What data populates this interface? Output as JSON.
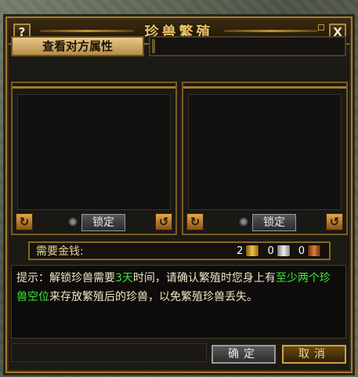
{
  "window": {
    "title": "珍兽繁殖",
    "help_label": "?",
    "close_label": "X"
  },
  "top": {
    "view_button": "查看对方属性"
  },
  "left_panel": {
    "rotate_left_icon": "rotate-left-icon",
    "rotate_right_icon": "rotate-right-icon",
    "lock_label": "锁定"
  },
  "right_panel": {
    "rotate_left_icon": "rotate-left-icon",
    "rotate_right_icon": "rotate-right-icon",
    "lock_label": "锁定"
  },
  "money": {
    "label": "需要金钱:",
    "gold": "2",
    "silver": "0",
    "copper": "0"
  },
  "tip": {
    "p1": "提示：解锁珍兽需要",
    "h1": "3天",
    "p2": "时间，请确认繁殖时您身上有",
    "h2": "至少两个珍兽空位",
    "p3": "来存放繁殖后的珍兽，以免繁殖珍兽丢失。"
  },
  "buttons": {
    "confirm": "确定",
    "cancel": "取消"
  },
  "colors": {
    "accent": "#c39236",
    "highlight": "#38e838"
  }
}
